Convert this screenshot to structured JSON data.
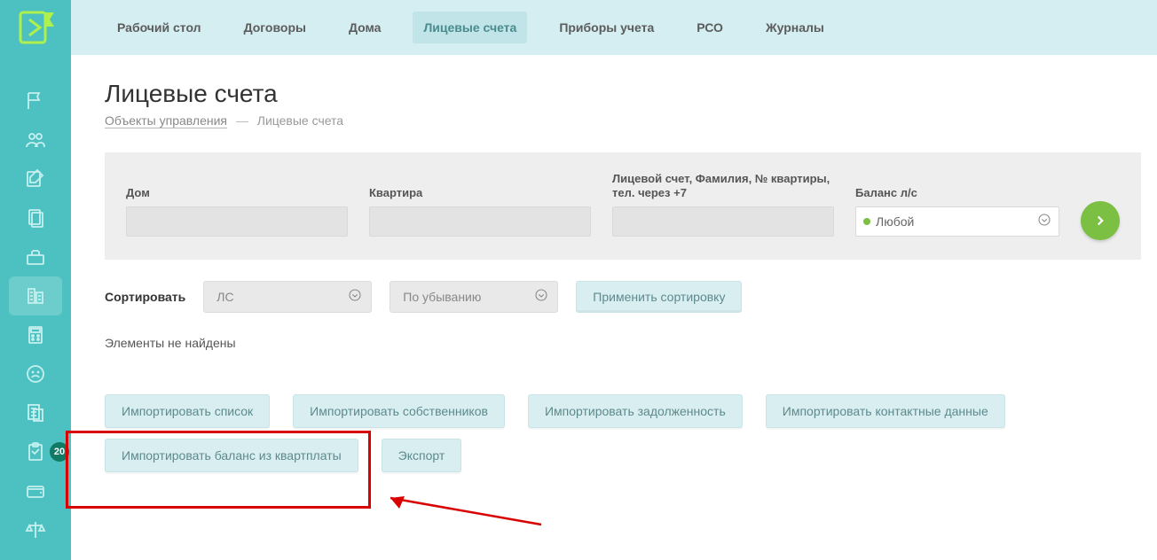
{
  "topnav": {
    "items": [
      {
        "label": "Рабочий стол"
      },
      {
        "label": "Договоры"
      },
      {
        "label": "Дома"
      },
      {
        "label": "Лицевые счета",
        "active": true
      },
      {
        "label": "Приборы учета"
      },
      {
        "label": "РСО"
      },
      {
        "label": "Журналы"
      }
    ]
  },
  "page": {
    "title": "Лицевые счета",
    "breadcrumb_link": "Объекты управления",
    "breadcrumb_current": "Лицевые счета"
  },
  "filters": {
    "house_label": "Дом",
    "house_value": "",
    "apartment_label": "Квартира",
    "apartment_value": "",
    "search_label": "Лицевой счет, Фамилия, № квартиры, тел. через +7",
    "search_value": "",
    "balance_label": "Баланс л/с",
    "balance_selected": "Любой"
  },
  "sort": {
    "label": "Сортировать",
    "field_selected": "ЛС",
    "order_selected": "По убыванию",
    "apply_label": "Применить сортировку"
  },
  "empty_text": "Элементы не найдены",
  "actions": {
    "import_list": "Импортировать список",
    "import_owners": "Импортировать собственников",
    "import_debt": "Импортировать задолженность",
    "import_contacts": "Импортировать контактные данные",
    "import_balance": "Импортировать баланс из квартплаты",
    "export": "Экспорт"
  },
  "sidebar": {
    "badge_count": "20"
  }
}
